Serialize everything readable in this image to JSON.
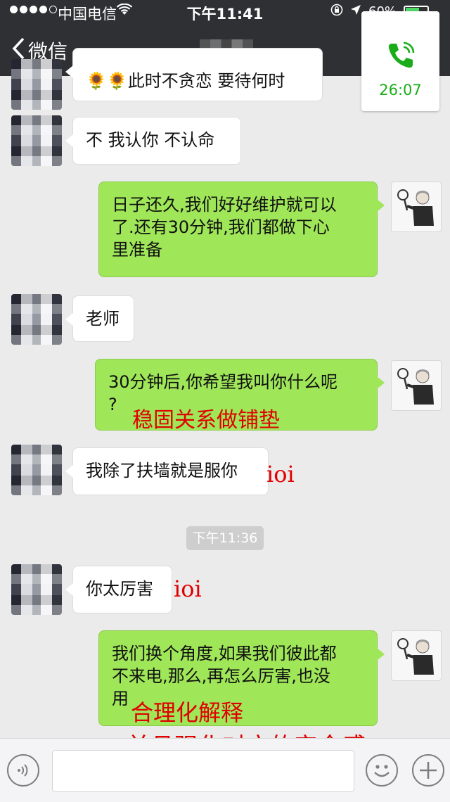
{
  "status_bar": {
    "carrier": "中国电信",
    "time": "下午11:41",
    "battery": "60%"
  },
  "nav": {
    "back_label": "微信"
  },
  "call_overlay": {
    "duration": "26:07",
    "icon": "phone-icon",
    "color": "#1aad19"
  },
  "messages": [
    {
      "side": "in",
      "text": "🌻🌻此时不贪恋 要待何时"
    },
    {
      "side": "in",
      "text": "不 我认你 不认命"
    },
    {
      "side": "out",
      "lines": [
        "日子还久,我们好好维护就可以",
        "了.还有30分钟,我们都做下心",
        "里准备"
      ]
    },
    {
      "side": "in",
      "text": "老师"
    },
    {
      "side": "out",
      "lines": [
        "30分钟后,你希望我叫你什么呢",
        "?"
      ]
    },
    {
      "side": "in",
      "text": "我除了扶墙就是服你"
    },
    {
      "side": "in",
      "text": "你太厉害"
    },
    {
      "side": "out",
      "lines": [
        "我们换个角度,如果我们彼此都",
        "不来电,那么,再怎么厉害,也没",
        "用"
      ]
    }
  ],
  "timestamp": "下午11:36",
  "annotations": {
    "a1": "稳固关系做铺垫",
    "a2": "ioi",
    "a3": "ioi",
    "a4": "合理化解释",
    "a5": "并且强化对方的安全感",
    "color": "#e00000"
  },
  "colors": {
    "outgoing_bubble": "#9fe658",
    "incoming_bubble": "#ffffff",
    "header_bg": "#2f3033",
    "chat_bg": "#ebebeb"
  }
}
